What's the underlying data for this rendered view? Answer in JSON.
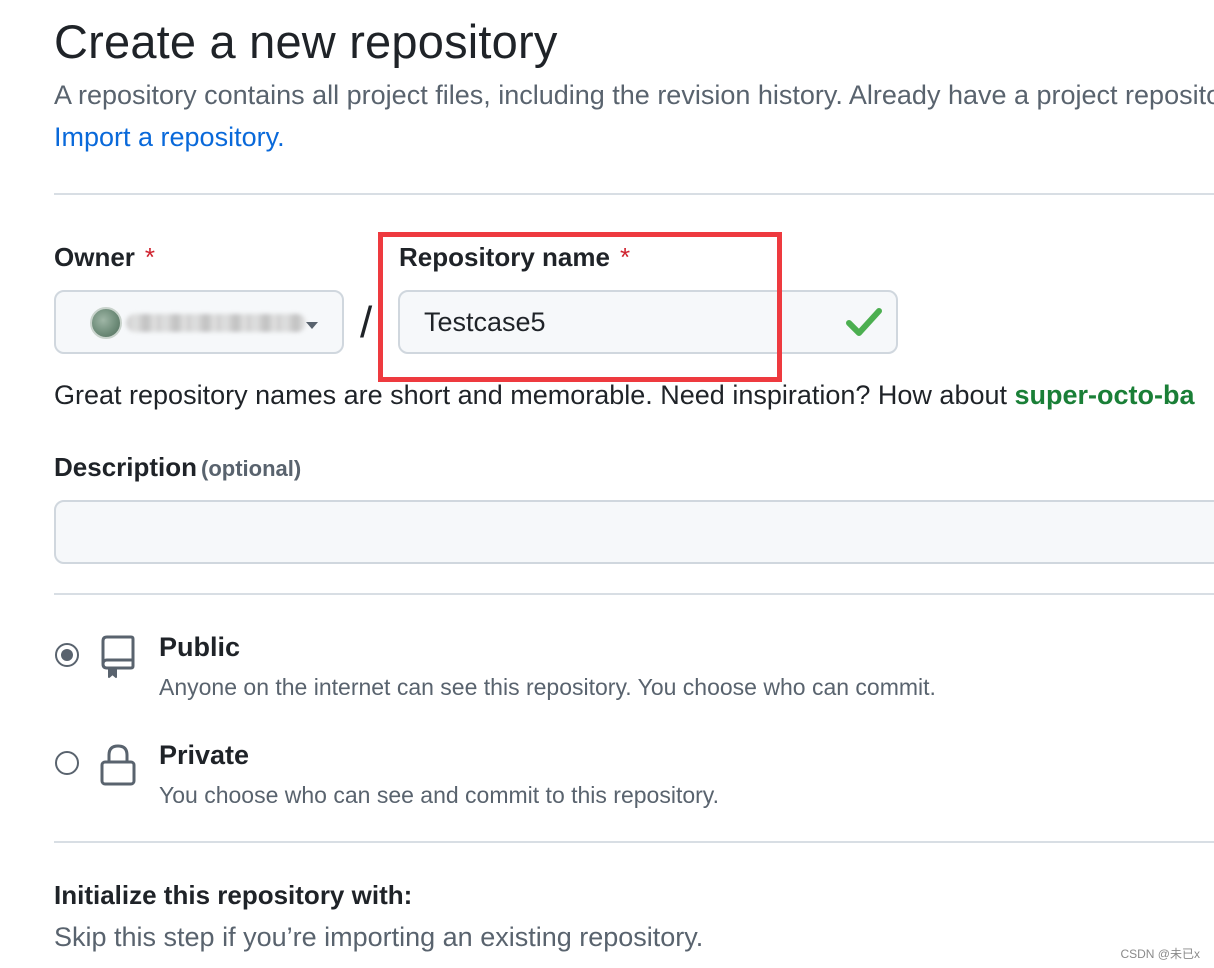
{
  "header": {
    "title": "Create a new repository",
    "intro": "A repository contains all project files, including the revision history. Already have a project repository elsewhere?",
    "import_link": "Import a repository."
  },
  "owner": {
    "label": "Owner",
    "required_mark": "*",
    "separator": "/"
  },
  "repository_name": {
    "label": "Repository name",
    "required_mark": "*",
    "value": "Testcase5",
    "valid_icon": "check-icon"
  },
  "name_hint": {
    "text": "Great repository names are short and memorable. Need inspiration? How about ",
    "suggestion": "super-octo-ba"
  },
  "description": {
    "label": "Description",
    "optional": "(optional)",
    "value": ""
  },
  "visibility": {
    "options": [
      {
        "title": "Public",
        "description": "Anyone on the internet can see this repository. You choose who can commit.",
        "icon": "repo-book-icon",
        "selected": true
      },
      {
        "title": "Private",
        "description": "You choose who can see and commit to this repository.",
        "icon": "lock-icon",
        "selected": false
      }
    ]
  },
  "initialize": {
    "heading": "Initialize this repository with:",
    "subtext": "Skip this step if you’re importing an existing repository."
  },
  "watermark": "CSDN @未已x",
  "colors": {
    "text": "#1f2328",
    "muted": "#59636e",
    "link": "#0969da",
    "success": "#1a7f37",
    "check": "#4caf50",
    "required": "#cf222e",
    "highlight": "#ee3a3f",
    "border": "#d0d7de",
    "input_bg": "#f6f8fa"
  }
}
